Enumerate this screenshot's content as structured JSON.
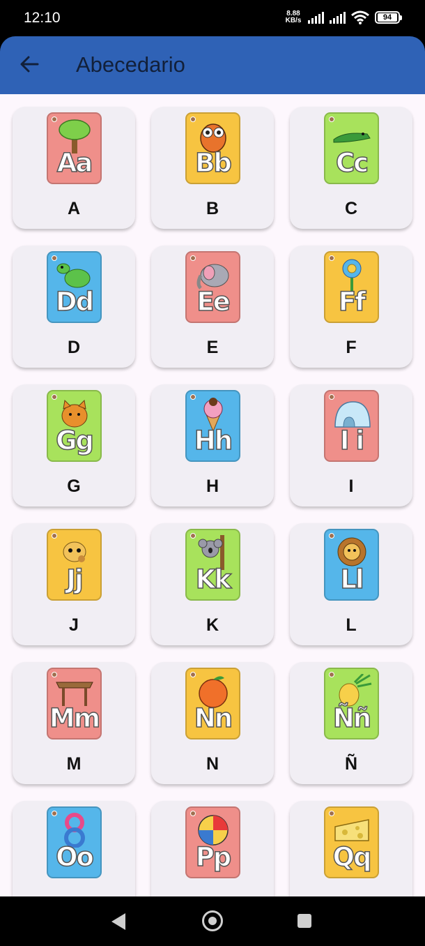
{
  "status": {
    "time": "12:10",
    "net_speed_value": "8.88",
    "net_speed_unit": "KB/s",
    "battery": "94"
  },
  "app_bar": {
    "title": "Abecedario",
    "back_icon": "arrow-left-icon"
  },
  "colors": {
    "app_bar": "#2f62b6",
    "background": "#fdf7fd",
    "card": "#f1eef4",
    "flash_red": "#ef8f8a",
    "flash_yellow": "#f7c441",
    "flash_green": "#a8e25c",
    "flash_blue": "#55b6ea"
  },
  "letters": [
    {
      "label": "A",
      "pair": "Aa",
      "color": "#ef8f8a",
      "picture": "tree"
    },
    {
      "label": "B",
      "pair": "Bb",
      "color": "#f7c441",
      "picture": "owl"
    },
    {
      "label": "C",
      "pair": "Cc",
      "color": "#a8e25c",
      "picture": "crocodile"
    },
    {
      "label": "D",
      "pair": "Dd",
      "color": "#55b6ea",
      "picture": "dinosaur"
    },
    {
      "label": "E",
      "pair": "Ee",
      "color": "#ef8f8a",
      "picture": "elephant"
    },
    {
      "label": "F",
      "pair": "Ff",
      "color": "#f7c441",
      "picture": "flower"
    },
    {
      "label": "G",
      "pair": "Gg",
      "color": "#a8e25c",
      "picture": "cat"
    },
    {
      "label": "H",
      "pair": "Hh",
      "color": "#55b6ea",
      "picture": "ice-cream"
    },
    {
      "label": "I",
      "pair": "I i",
      "color": "#ef8f8a",
      "picture": "igloo"
    },
    {
      "label": "J",
      "pair": "Jj",
      "color": "#f7c441",
      "picture": "giraffe"
    },
    {
      "label": "K",
      "pair": "Kk",
      "color": "#a8e25c",
      "picture": "koala"
    },
    {
      "label": "L",
      "pair": "Ll",
      "color": "#55b6ea",
      "picture": "lion"
    },
    {
      "label": "M",
      "pair": "Mm",
      "color": "#ef8f8a",
      "picture": "table"
    },
    {
      "label": "N",
      "pair": "Nn",
      "color": "#f7c441",
      "picture": "orange"
    },
    {
      "label": "Ñ",
      "pair": "Ññ",
      "color": "#a8e25c",
      "picture": "pineapple"
    },
    {
      "label": "",
      "pair": "Oo",
      "color": "#55b6ea",
      "picture": "eight"
    },
    {
      "label": "",
      "pair": "Pp",
      "color": "#ef8f8a",
      "picture": "ball"
    },
    {
      "label": "",
      "pair": "Qq",
      "color": "#f7c441",
      "picture": "cheese"
    }
  ]
}
